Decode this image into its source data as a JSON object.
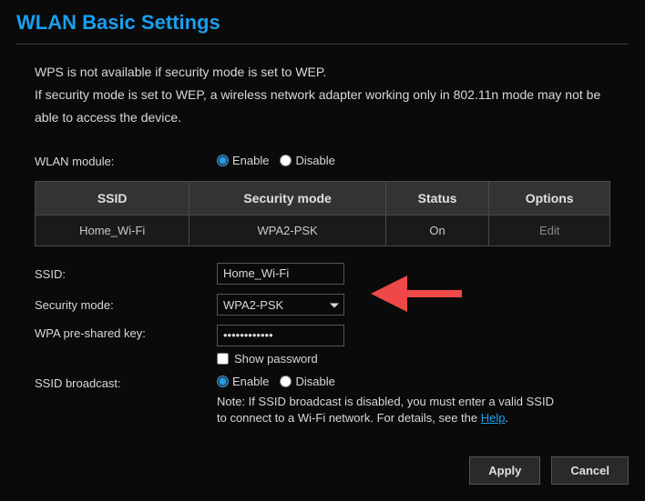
{
  "page": {
    "title": "WLAN Basic Settings",
    "info_line1": "WPS is not available if security mode is set to WEP.",
    "info_line2": "If security mode is set to WEP, a wireless network adapter working only in 802.11n mode may not be able to access the device."
  },
  "wlan_module": {
    "label": "WLAN module:",
    "enable_label": "Enable",
    "disable_label": "Disable",
    "value": "enable"
  },
  "table": {
    "headers": {
      "ssid": "SSID",
      "security_mode": "Security mode",
      "status": "Status",
      "options": "Options"
    },
    "rows": [
      {
        "ssid": "Home_Wi-Fi",
        "security_mode": "WPA2-PSK",
        "status": "On",
        "options": "Edit"
      }
    ]
  },
  "form": {
    "ssid": {
      "label": "SSID:",
      "value": "Home_Wi-Fi"
    },
    "security_mode": {
      "label": "Security mode:",
      "value": "WPA2-PSK"
    },
    "wpa_key": {
      "label": "WPA pre-shared key:",
      "value": "••••••••••••"
    },
    "show_password": {
      "label": "Show password"
    },
    "ssid_broadcast": {
      "label": "SSID broadcast:",
      "enable_label": "Enable",
      "disable_label": "Disable",
      "value": "enable",
      "note_prefix": "Note: If SSID broadcast is disabled, you must enter a valid SSID to connect to a Wi-Fi network. For details, see the ",
      "help_text": "Help",
      "note_suffix": "."
    }
  },
  "buttons": {
    "apply": "Apply",
    "cancel": "Cancel"
  }
}
